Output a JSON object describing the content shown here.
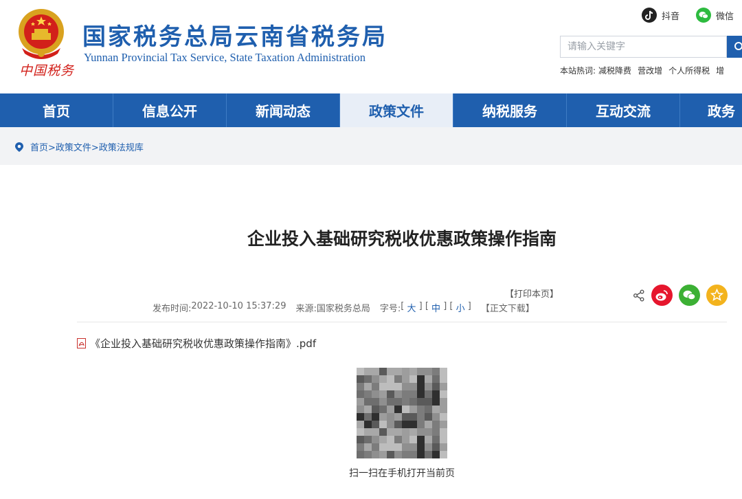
{
  "header": {
    "title": "国家税务总局云南省税务局",
    "subtitle": "Yunnan Provincial Tax Service, State Taxation Administration",
    "logo_script": "中国税务",
    "social": [
      {
        "label": "抖音",
        "icon": "douyin-icon"
      },
      {
        "label": "微信",
        "icon": "wechat-icon"
      }
    ],
    "search": {
      "placeholder": "请输入关键字"
    },
    "hot_label": "本站热词:",
    "hot_words": [
      "减税降费",
      "营改增",
      "个人所得税",
      "增"
    ]
  },
  "nav": {
    "items": [
      "首页",
      "信息公开",
      "新闻动态",
      "政策文件",
      "纳税服务",
      "互动交流",
      "政务"
    ],
    "active": "政策文件"
  },
  "breadcrumb": {
    "items": [
      "首页>",
      "政策文件>",
      "政策法规库"
    ]
  },
  "article": {
    "title": "企业投入基础研究税收优惠政策操作指南",
    "print_label": "【打印本页】",
    "download_label": "【正文下载】",
    "publish_label": "发布时间:",
    "publish_time": "2022-10-10 15:37:29",
    "source_label": "来源:",
    "source": "国家税务总局",
    "font_label": "字号:",
    "font_sizes": [
      "大",
      "中",
      "小"
    ],
    "attachment": "《企业投入基础研究税收优惠政策操作指南》.pdf",
    "qr_caption": "扫一扫在手机打开当前页"
  },
  "colors": {
    "brand_blue": "#1f5fae",
    "weibo_red": "#e6162d",
    "wechat_green": "#3cb034",
    "favorite_yellow": "#f3b31d"
  }
}
